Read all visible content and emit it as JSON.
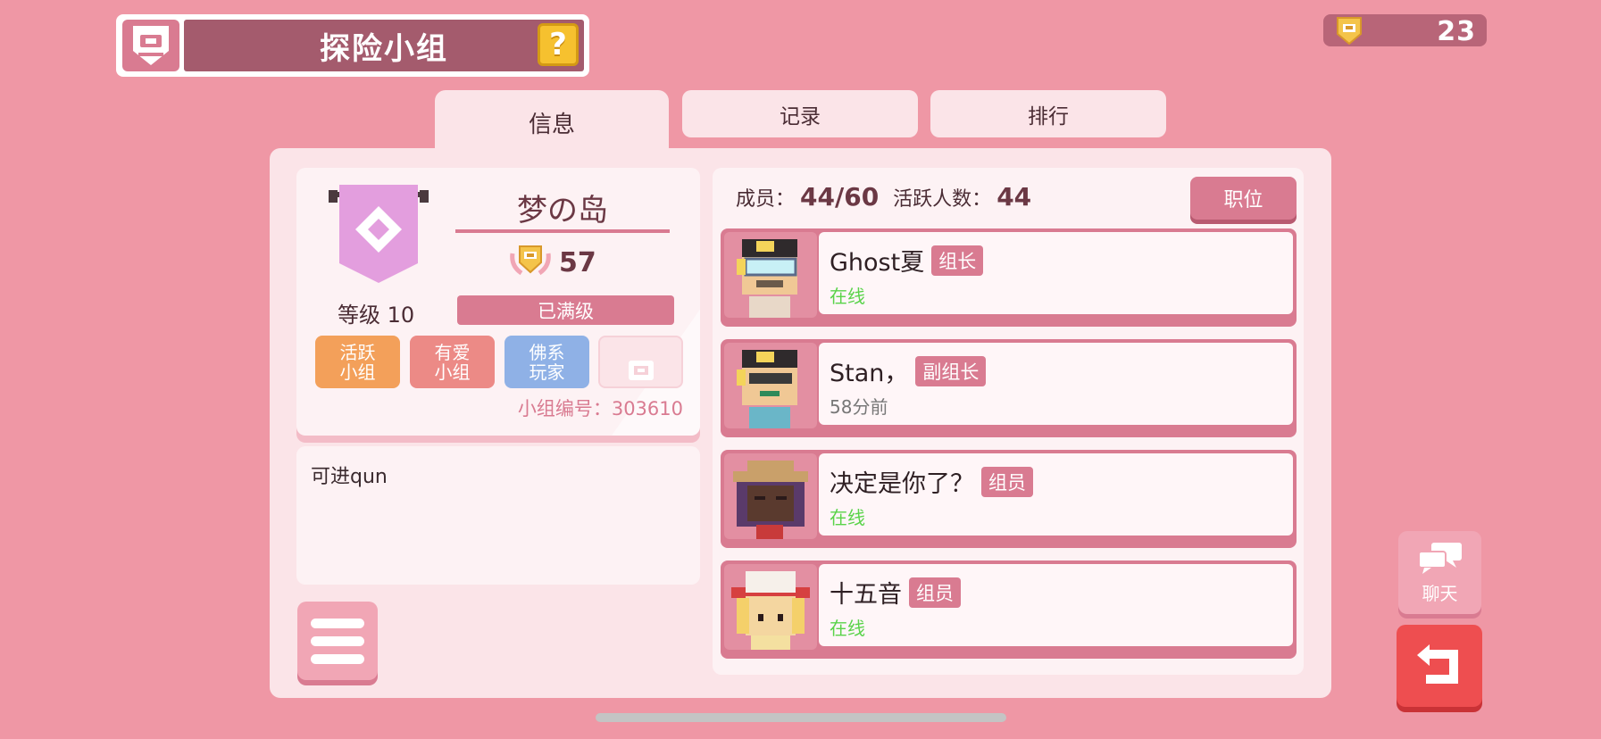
{
  "header": {
    "title": "探险小组",
    "help_label": "?",
    "currency_value": "23"
  },
  "tabs": [
    {
      "label": "信息",
      "active": true
    },
    {
      "label": "记录",
      "active": false
    },
    {
      "label": "排行",
      "active": false
    }
  ],
  "group": {
    "name": "梦の岛",
    "score": "57",
    "level_label": "等级 10",
    "level_status": "已满级",
    "tags": [
      {
        "label": "活跃\n小组",
        "color": "#f3a05a"
      },
      {
        "label": "有爱\n小组",
        "color": "#ec8a86"
      },
      {
        "label": "佛系\n玩家",
        "color": "#8fb1e6"
      }
    ],
    "group_id_label": "小组编号：303610",
    "notice": "可进qun"
  },
  "members": {
    "members_label": "成员：",
    "members_count": "44/60",
    "active_label": "活跃人数：",
    "active_count": "44",
    "roles_button": "职位",
    "list": [
      {
        "name": "Ghost夏",
        "role": "组长",
        "status": "在线",
        "online": true
      },
      {
        "name": "Stan，",
        "role": "副组长",
        "status": "58分前",
        "online": false
      },
      {
        "name": "决定是你了？",
        "role": "组员",
        "status": "在线",
        "online": true
      },
      {
        "name": "十五音",
        "role": "组员",
        "status": "在线",
        "online": true
      }
    ]
  },
  "side_buttons": {
    "chat_label": "聊天"
  },
  "colors": {
    "background": "#ef97a5",
    "accent": "#d97b91",
    "online": "#5ad34a",
    "back_button": "#ee4e50"
  }
}
